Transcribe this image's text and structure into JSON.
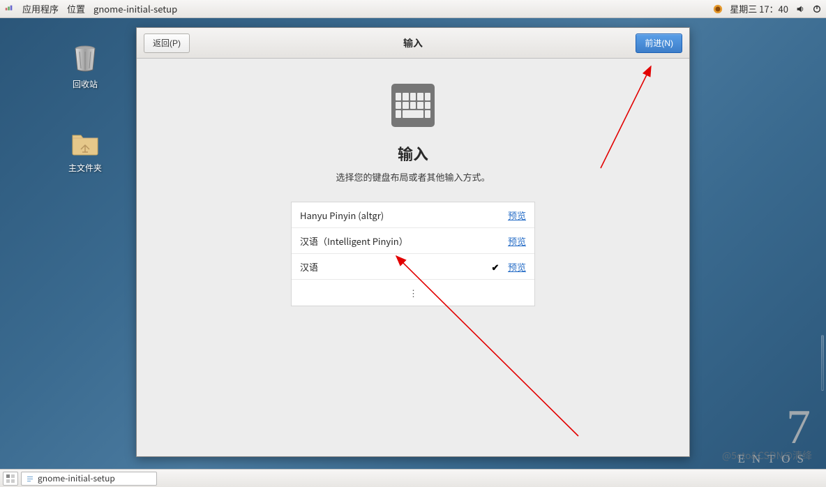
{
  "panel": {
    "applications": "应用程序",
    "places": "位置",
    "appname": "gnome-initial-setup",
    "datetime": "星期三 17：40"
  },
  "desktop": {
    "trash": "回收站",
    "home": "主文件夹"
  },
  "dialog": {
    "back": "返回(P)",
    "title": "输入",
    "forward": "前进(N)",
    "heading": "输入",
    "description": "选择您的键盘布局或者其他输入方式。",
    "preview_label": "预览",
    "inputs": [
      {
        "name": "Hanyu Pinyin (altgr)",
        "selected": false
      },
      {
        "name": "汉语（Intelligent Pinyin）",
        "selected": false
      },
      {
        "name": "汉语",
        "selected": true
      }
    ],
    "more": "⋮"
  },
  "taskbar": {
    "app": "gnome-initial-setup"
  },
  "watermark": {
    "centos": "ENTOS",
    "seven": "7",
    "csdn": "@5cto&CSDN@清绛"
  }
}
